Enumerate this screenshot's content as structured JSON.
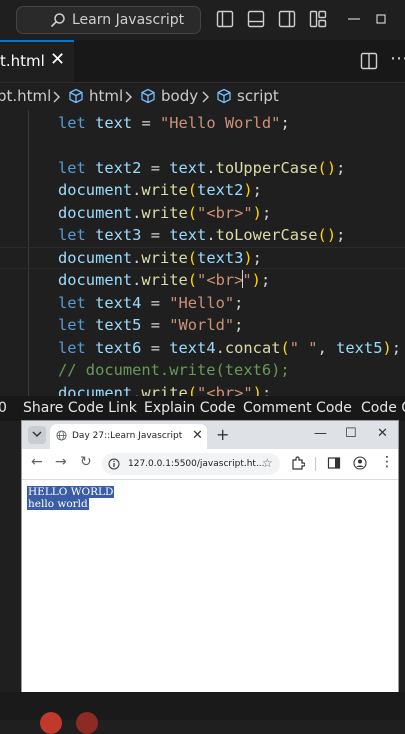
{
  "titlebar": {
    "search_placeholder": "Learn Javascript"
  },
  "editor": {
    "tab_name": "t.html",
    "tab_close": "✕",
    "breadcrumbs": {
      "file": "pt.html",
      "html": "html",
      "body": "body",
      "script": "script"
    },
    "code": {
      "l1": {
        "kw": "let",
        "var": "text",
        "op": " = ",
        "str": "\"Hello World\"",
        "end": ";"
      },
      "l3": {
        "kw": "let",
        "var": "text2",
        "op": " = ",
        "obj": "text",
        "dot": ".",
        "fn": "toUpperCase",
        "open": "(",
        "close": ")",
        "end": ";"
      },
      "l4": {
        "obj": "document",
        "dot": ".",
        "fn": "write",
        "open": "(",
        "arg": "text2",
        "close": ")",
        "end": ";"
      },
      "l5": {
        "obj": "document",
        "dot": ".",
        "fn": "write",
        "open": "(",
        "str": "\"<br>\"",
        "close": ")",
        "end": ";"
      },
      "l6": {
        "kw": "let",
        "var": "text3",
        "op": " = ",
        "obj": "text",
        "dot": ".",
        "fn": "toLowerCase",
        "open": "(",
        "close": ")",
        "end": ";"
      },
      "l7": {
        "obj": "document",
        "dot": ".",
        "fn": "write",
        "open": "(",
        "arg": "text3",
        "close": ")",
        "end": ";"
      },
      "l8": {
        "obj": "document",
        "dot": ".",
        "fn": "write",
        "open": "(",
        "str_a": "\"<br>",
        "str_b": "\"",
        "close": ")",
        "end": ";"
      },
      "l9": {
        "kw": "let",
        "var": "text4",
        "op": " = ",
        "str": "\"Hello\"",
        "end": ";"
      },
      "l10": {
        "kw": "let",
        "var": "text5",
        "op": " = ",
        "str": "\"World\"",
        "end": ";"
      },
      "l11": {
        "kw": "let",
        "var": "text6",
        "op": " = ",
        "obj": "text4",
        "dot": ".",
        "fn": "concat",
        "open": "(",
        "str": "\" \"",
        "comma": ", ",
        "arg": "text5",
        "close": ")",
        "end": ";"
      },
      "l12": {
        "comment": "// document.write(text6);"
      },
      "l13": {
        "obj": "document",
        "dot": ".",
        "fn": "write",
        "open": "(",
        "str": "\"<br>\"",
        "close": ")",
        "end": ";"
      }
    }
  },
  "commandbar": {
    "left": "0",
    "share": "Share Code Link",
    "explain": "Explain Code",
    "comment": "Comment Code",
    "code": "Code C"
  },
  "browser": {
    "tab_title": "Day 27::Learn Javascript",
    "tab_close": "✕",
    "new_tab": "+",
    "win_min": "—",
    "win_max": "☐",
    "win_close": "✕",
    "back": "←",
    "forward": "→",
    "reload": "↻",
    "url": "127.0.0.1:5500/javascript.ht...",
    "star": "☆",
    "menu": "⋮",
    "output_upper": "HELLO WORLD",
    "output_lower": "hello world"
  }
}
